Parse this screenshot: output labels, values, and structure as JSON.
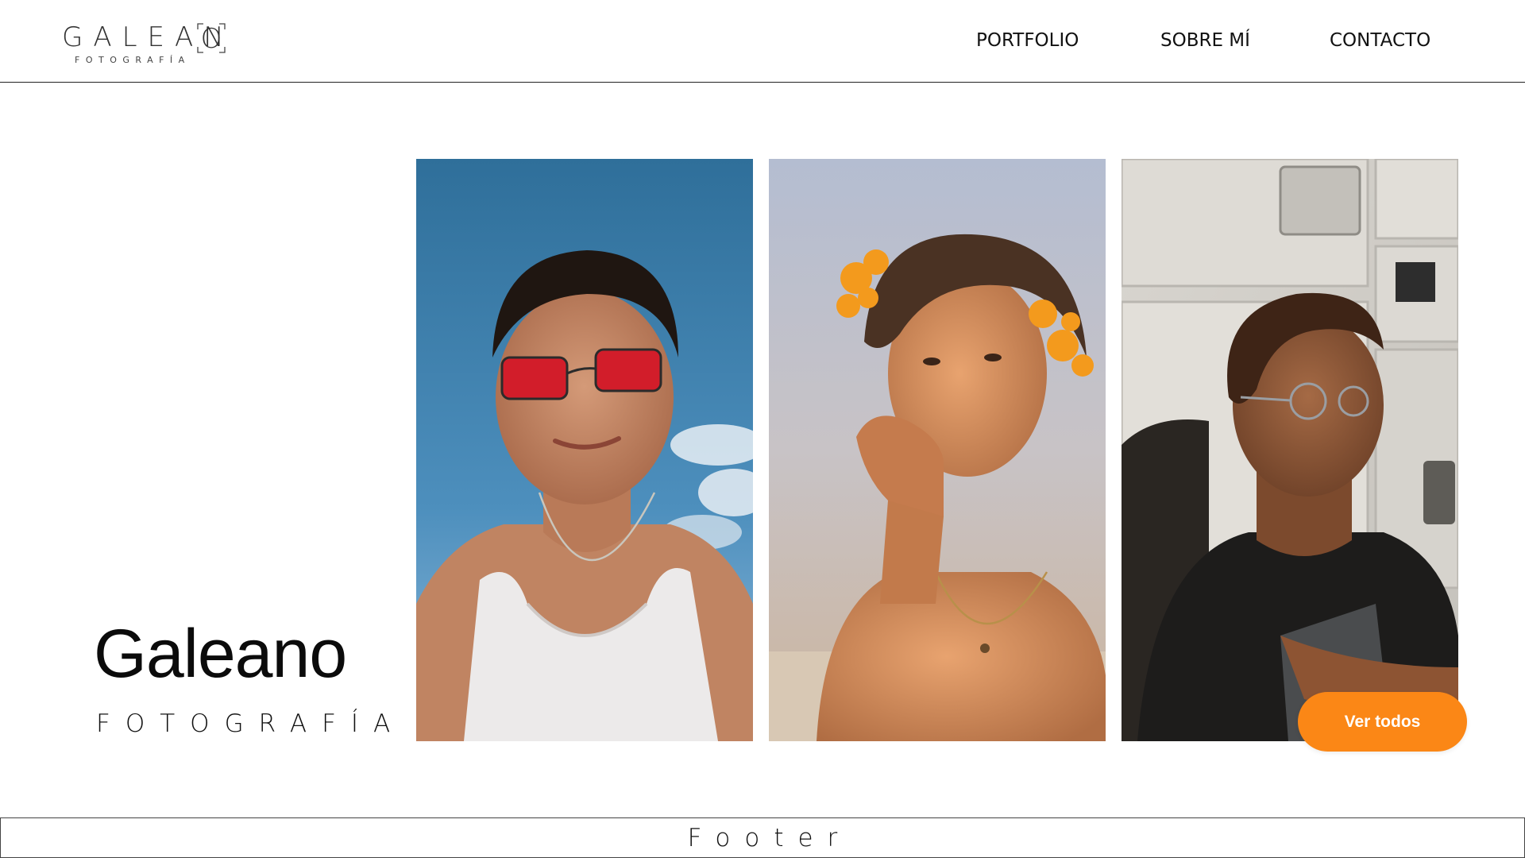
{
  "header": {
    "logo": {
      "word": "GALEAN",
      "bracket_letter": "O",
      "sub": "FOTOGRAFÍA"
    },
    "nav": {
      "portfolio": "PORTFOLIO",
      "about": "SOBRE MÍ",
      "contact": "CONTACTO"
    }
  },
  "hero": {
    "title": "Galeano",
    "subtitle": "FOTOGRAFÍA"
  },
  "gallery": {
    "photos": [
      {
        "subject": "young man with red sunglasses and white tank top against blue sky"
      },
      {
        "subject": "young man with orange flowers in hair resting chin on hand"
      },
      {
        "subject": "young man with curly hair and glasses by laundry machines"
      }
    ],
    "view_all_label": "Ver todos"
  },
  "footer": {
    "label": "Footer"
  },
  "colors": {
    "accent": "#fb8716",
    "text": "#111111",
    "background": "#ffffff"
  }
}
